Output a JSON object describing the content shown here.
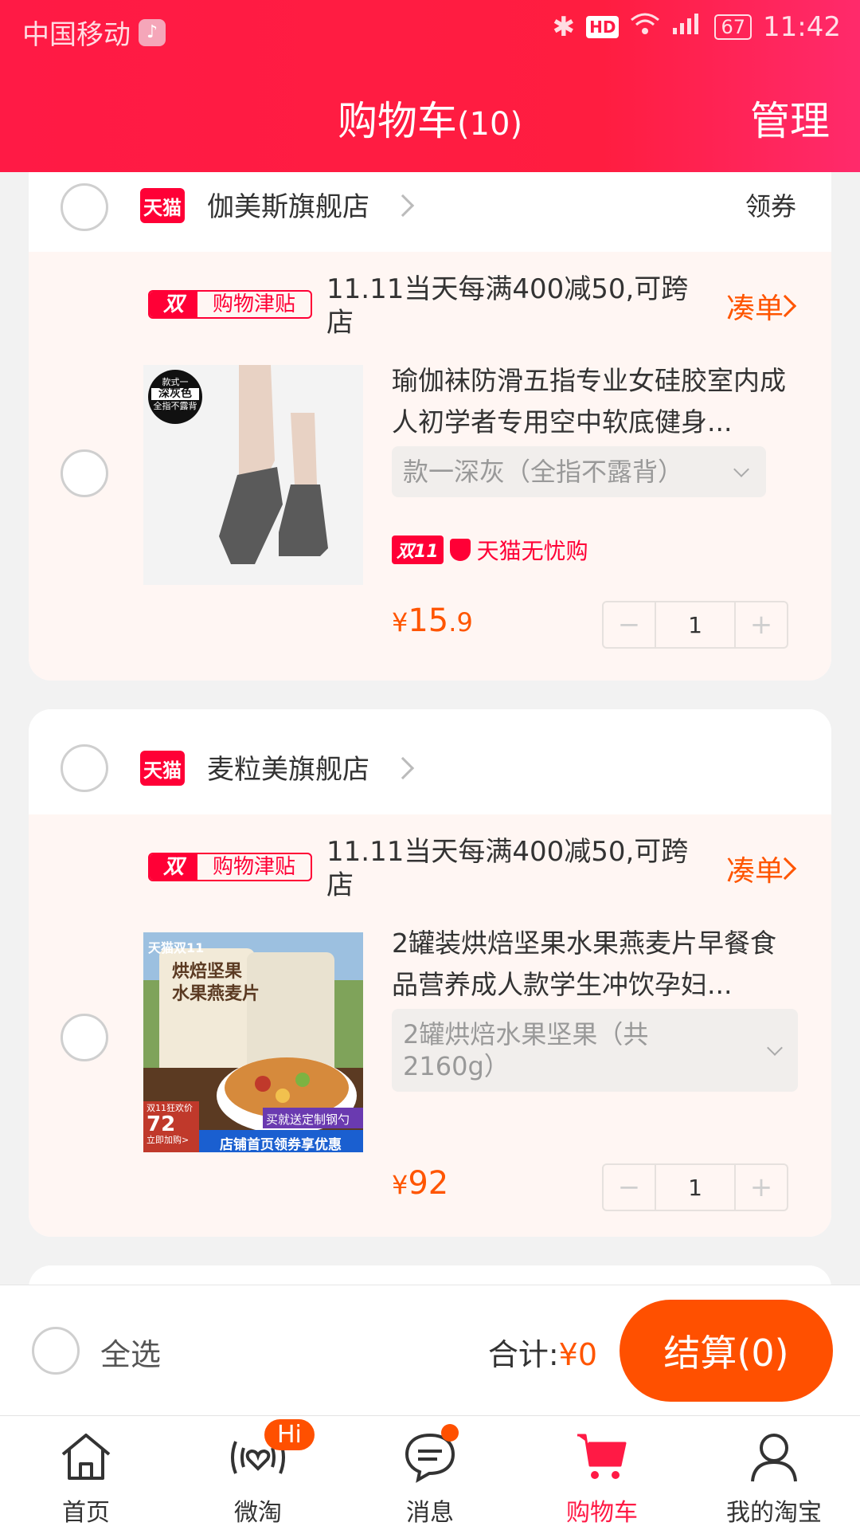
{
  "status_bar": {
    "carrier": "中国移动",
    "hd": "HD",
    "battery": "67",
    "time": "11:42"
  },
  "header": {
    "title": "购物车",
    "count": "(10)",
    "manage": "管理"
  },
  "tmall_logo_text": "天猫",
  "promo": {
    "tag_left": "双11",
    "tag_right": "购物津贴",
    "cou_dan": "凑单"
  },
  "shops": [
    {
      "name": "伽美斯旗舰店",
      "coupon": "领券",
      "promo_text": "11.11当天每满400减50,可跨店",
      "item": {
        "title": "瑜伽袜防滑五指专业女硅胶室内成人初学者专用空中软底健身...",
        "sku": "款一深灰（全指不露背）",
        "badge": "天猫无忧购",
        "badge_tag": "双11",
        "price_symbol": "¥",
        "price_int": "15",
        "price_dec": ".9",
        "quantity": "1",
        "thumb_label_1": "款式一",
        "thumb_label_2": "深灰色",
        "thumb_label_3": "全指不露背"
      }
    },
    {
      "name": "麦粒美旗舰店",
      "promo_text": "11.11当天每满400减50,可跨店",
      "item": {
        "title": "2罐装烘焙坚果水果燕麦片早餐食品营养成人款学生冲饮孕妇...",
        "sku": "2罐烘焙水果坚果（共2160g）",
        "price_symbol": "¥",
        "price_int": "92",
        "quantity": "1",
        "thumb_top": "天猫双11",
        "thumb_title_1": "烘焙坚果",
        "thumb_title_2": "水果燕麦片",
        "thumb_price_label": "双11狂欢价",
        "thumb_price": "72",
        "thumb_buy": "立即加购>",
        "thumb_gift": "买就送定制钢勺",
        "thumb_bottom": "店铺首页领券享优惠"
      }
    }
  ],
  "checkout": {
    "select_all": "全选",
    "total_label": "合计:",
    "total_amount": "¥0",
    "button": "结算(0)"
  },
  "tabs": [
    {
      "label": "首页",
      "icon": "home-icon"
    },
    {
      "label": "微淘",
      "icon": "weitao-icon",
      "badge": "Hi"
    },
    {
      "label": "消息",
      "icon": "message-icon"
    },
    {
      "label": "购物车",
      "icon": "cart-icon",
      "active": true
    },
    {
      "label": "我的淘宝",
      "icon": "profile-icon"
    }
  ],
  "colors": {
    "brand_red": "#ff1a45",
    "price_orange": "#ff5500",
    "checkout_orange": "#ff5000"
  }
}
